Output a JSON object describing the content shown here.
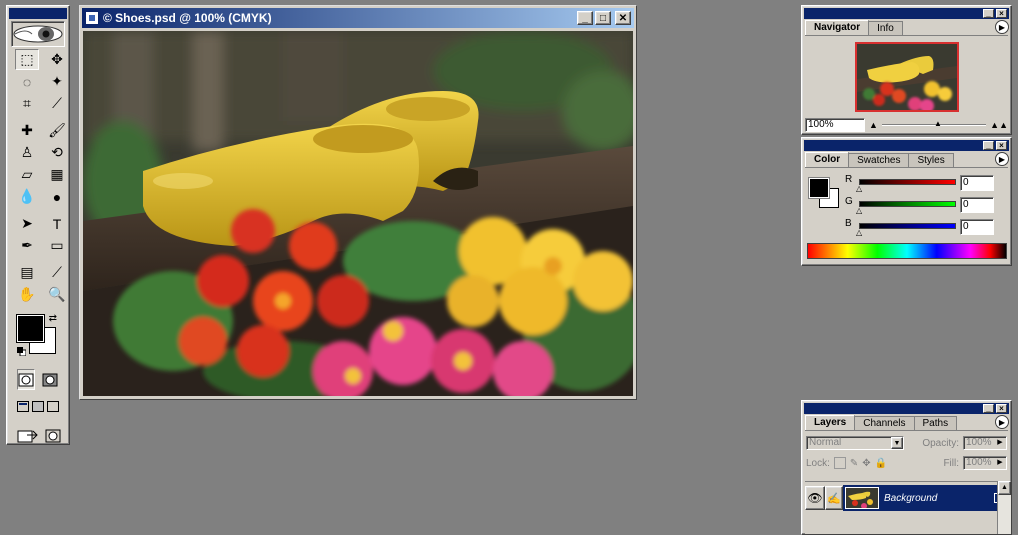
{
  "document": {
    "title": "© Shoes.psd @ 100% (CMYK)",
    "minimize_label": "_",
    "maximize_label": "□",
    "close_label": "✕"
  },
  "toolbox": {
    "tools": [
      {
        "name": "marquee-tool-icon",
        "glyph": "⬚"
      },
      {
        "name": "move-tool-icon",
        "glyph": "✥"
      },
      {
        "name": "lasso-tool-icon",
        "glyph": "◌"
      },
      {
        "name": "magic-wand-tool-icon",
        "glyph": "✦"
      },
      {
        "name": "crop-tool-icon",
        "glyph": "⌗"
      },
      {
        "name": "slice-tool-icon",
        "glyph": "⟋"
      },
      {
        "name": "healing-brush-tool-icon",
        "glyph": "✚"
      },
      {
        "name": "brush-tool-icon",
        "glyph": "🖌"
      },
      {
        "name": "clone-stamp-tool-icon",
        "glyph": "♙"
      },
      {
        "name": "history-brush-tool-icon",
        "glyph": "⟲"
      },
      {
        "name": "eraser-tool-icon",
        "glyph": "▱"
      },
      {
        "name": "gradient-tool-icon",
        "glyph": "▦"
      },
      {
        "name": "blur-tool-icon",
        "glyph": "💧"
      },
      {
        "name": "dodge-tool-icon",
        "glyph": "●"
      },
      {
        "name": "path-selection-tool-icon",
        "glyph": "➤"
      },
      {
        "name": "type-tool-icon",
        "glyph": "T"
      },
      {
        "name": "pen-tool-icon",
        "glyph": "✒"
      },
      {
        "name": "rectangle-tool-icon",
        "glyph": "▭"
      },
      {
        "name": "notes-tool-icon",
        "glyph": "▤"
      },
      {
        "name": "eyedropper-tool-icon",
        "glyph": "⟋"
      },
      {
        "name": "hand-tool-icon",
        "glyph": "✋"
      },
      {
        "name": "zoom-tool-icon",
        "glyph": "🔍"
      }
    ]
  },
  "navigator": {
    "tabs": [
      "Navigator",
      "Info"
    ],
    "zoom_value": "100%",
    "zoom_out": "▲",
    "zoom_in": "▲▲"
  },
  "color": {
    "tabs": [
      "Color",
      "Swatches",
      "Styles"
    ],
    "channels": [
      {
        "label": "R",
        "value": "0",
        "gradient": "linear-gradient(to right,#000,#ff0000)"
      },
      {
        "label": "G",
        "value": "0",
        "gradient": "linear-gradient(to right,#000,#00ff00)"
      },
      {
        "label": "B",
        "value": "0",
        "gradient": "linear-gradient(to right,#000,#0000ff)"
      }
    ]
  },
  "layers": {
    "tabs": [
      "Layers",
      "Channels",
      "Paths"
    ],
    "blend_mode": "Normal",
    "opacity_label": "Opacity:",
    "opacity_value": "100%",
    "lock_label": "Lock:",
    "fill_label": "Fill:",
    "fill_value": "100%",
    "items": [
      {
        "name": "Background"
      }
    ]
  },
  "colors": {
    "title_dark": "#0a246a",
    "title_light": "#a6caf0",
    "chrome": "#d4d0c8",
    "workspace": "#808080"
  }
}
